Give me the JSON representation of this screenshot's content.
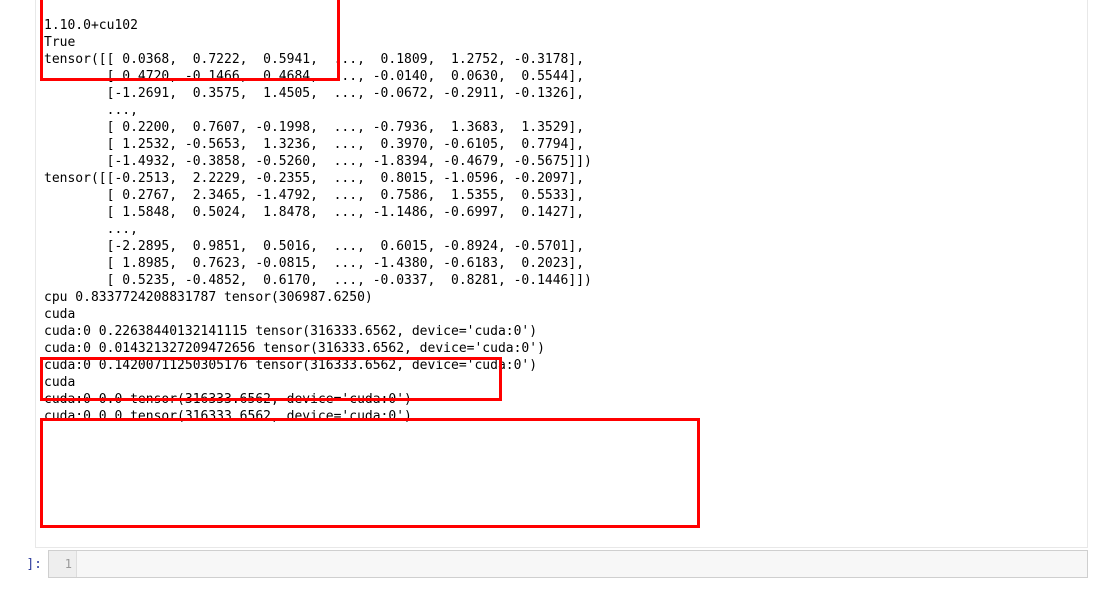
{
  "output": {
    "line01": "1.10.0+cu102",
    "line02": "True",
    "line03": "tensor([[ 0.0368,  0.7222,  0.5941,  ...,  0.1809,  1.2752, -0.3178],",
    "line04": "        [ 0.4720, -0.1466,  0.4684,  ..., -0.0140,  0.0630,  0.5544],",
    "line05": "        [-1.2691,  0.3575,  1.4505,  ..., -0.0672, -0.2911, -0.1326],",
    "line06": "        ...,",
    "line07": "        [ 0.2200,  0.7607, -0.1998,  ..., -0.7936,  1.3683,  1.3529],",
    "line08": "        [ 1.2532, -0.5653,  1.3236,  ...,  0.3970, -0.6105,  0.7794],",
    "line09": "        [-1.4932, -0.3858, -0.5260,  ..., -1.8394, -0.4679, -0.5675]])",
    "line10": "tensor([[-0.2513,  2.2229, -0.2355,  ...,  0.8015, -1.0596, -0.2097],",
    "line11": "        [ 0.2767,  2.3465, -1.4792,  ...,  0.7586,  1.5355,  0.5533],",
    "line12": "        [ 1.5848,  0.5024,  1.8478,  ..., -1.1486, -0.6997,  0.1427],",
    "line13": "        ...,",
    "line14": "        [-2.2895,  0.9851,  0.5016,  ...,  0.6015, -0.8924, -0.5701],",
    "line15": "        [ 1.8985,  0.7623, -0.0815,  ..., -1.4380, -0.6183,  0.2023],",
    "line16": "        [ 0.5235, -0.4852,  0.6170,  ..., -0.0337,  0.8281, -0.1446]])",
    "line17": "cpu 0.8337724208831787 tensor(306987.6250)",
    "line18": "cuda",
    "line19": "cuda:0 0.22638440132141115 tensor(316333.6562, device='cuda:0')",
    "line20": "cuda:0 0.014321327209472656 tensor(316333.6562, device='cuda:0')",
    "line21": "cuda:0 0.14200711250305176 tensor(316333.6562, device='cuda:0')",
    "line22": "cuda",
    "line23": "cuda:0 0.0 tensor(316333.6562, device='cuda:0')",
    "line24": "cuda:0 0.0 tensor(316333.6562, device='cuda:0')"
  },
  "input": {
    "prompt": "]:",
    "gutter_line": "1",
    "code": ""
  },
  "highlight_color": "#ff0000"
}
